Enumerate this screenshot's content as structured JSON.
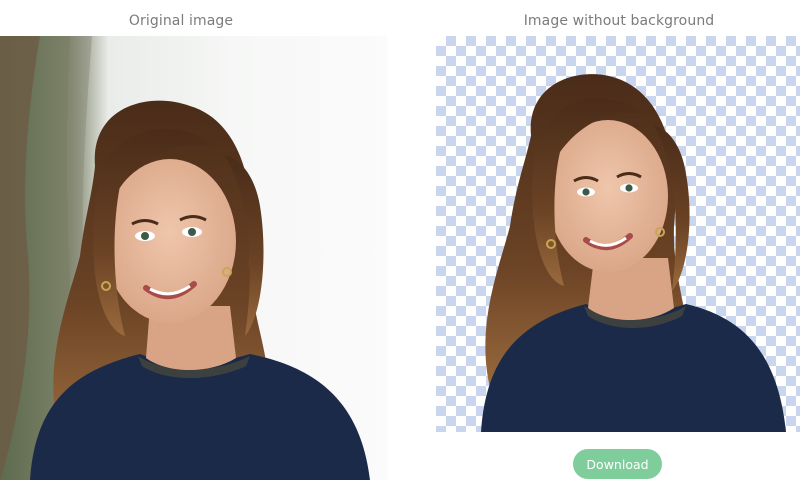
{
  "captions": {
    "original": "Original image",
    "result": "Image without background"
  },
  "actions": {
    "download_label": "Download"
  },
  "colors": {
    "accent": "#7fcd9b",
    "checker": "#c9d6ee",
    "caption_text": "#7b7b7b",
    "sweater": "#1c2a4a",
    "hair": "#5a3620",
    "skin": "#e6b89d"
  },
  "images": {
    "original": {
      "description_icon": "portrait-photo-icon"
    },
    "result": {
      "description_icon": "cutout-portrait-icon"
    }
  }
}
